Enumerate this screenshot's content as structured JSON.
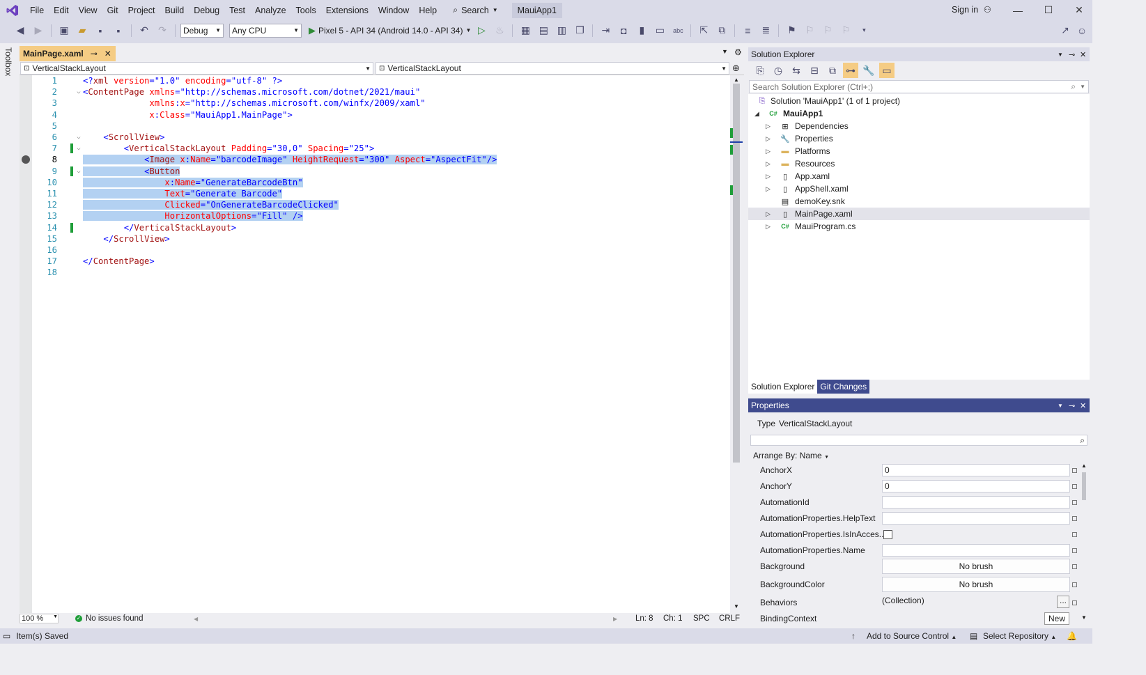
{
  "menu": {
    "items": [
      "File",
      "Edit",
      "View",
      "Git",
      "Project",
      "Build",
      "Debug",
      "Test",
      "Analyze",
      "Tools",
      "Extensions",
      "Window",
      "Help"
    ],
    "search_label": "Search",
    "solution_badge": "MauiApp1",
    "sign_in": "Sign in"
  },
  "toolbar": {
    "config": "Debug",
    "platform": "Any CPU",
    "run_target": "Pixel 5 - API 34 (Android 14.0 - API 34)"
  },
  "toolbox_label": "Toolbox",
  "editor": {
    "tab_title": "MainPage.xaml",
    "nav_left": "VerticalStackLayout",
    "nav_right": "VerticalStackLayout",
    "zoom": "100 %",
    "issues": "No issues found",
    "ln": "Ln: 8",
    "ch": "Ch: 1",
    "spc": "SPC",
    "crlf": "CRLF",
    "current_line": 8,
    "lines": [
      {
        "n": "1",
        "tokens": [
          [
            "c-blue",
            "<?"
          ],
          [
            "c-brown",
            "xml"
          ],
          [
            "c-red",
            " version"
          ],
          [
            "c-blue",
            "="
          ],
          [
            "c-str",
            "\"1.0\""
          ],
          [
            "c-red",
            " encoding"
          ],
          [
            "c-blue",
            "="
          ],
          [
            "c-str",
            "\"utf-8\""
          ],
          [
            "c-blue",
            " ?>"
          ]
        ]
      },
      {
        "n": "2",
        "tokens": [
          [
            "c-blue",
            "<"
          ],
          [
            "c-brown",
            "ContentPage"
          ],
          [
            "c-red",
            " xmlns"
          ],
          [
            "c-blue",
            "="
          ],
          [
            "c-str",
            "\"http://schemas.microsoft.com/dotnet/2021/maui\""
          ]
        ]
      },
      {
        "n": "3",
        "tokens": [
          [
            "",
            "             "
          ],
          [
            "c-red",
            "xmlns"
          ],
          [
            "c-blue",
            ":"
          ],
          [
            "c-red",
            "x"
          ],
          [
            "c-blue",
            "="
          ],
          [
            "c-str",
            "\"http://schemas.microsoft.com/winfx/2009/xaml\""
          ]
        ]
      },
      {
        "n": "4",
        "tokens": [
          [
            "",
            "             "
          ],
          [
            "c-red",
            "x"
          ],
          [
            "c-blue",
            ":"
          ],
          [
            "c-red",
            "Class"
          ],
          [
            "c-blue",
            "="
          ],
          [
            "c-str",
            "\"MauiApp1.MainPage\""
          ],
          [
            "c-blue",
            ">"
          ]
        ]
      },
      {
        "n": "5",
        "tokens": []
      },
      {
        "n": "6",
        "tokens": [
          [
            "",
            "    "
          ],
          [
            "c-blue",
            "<"
          ],
          [
            "c-brown",
            "ScrollView"
          ],
          [
            "c-blue",
            ">"
          ]
        ]
      },
      {
        "n": "7",
        "tokens": [
          [
            "",
            "        "
          ],
          [
            "c-blue",
            "<"
          ],
          [
            "c-brown",
            "VerticalStackLayout"
          ],
          [
            "c-red",
            " Padding"
          ],
          [
            "c-blue",
            "="
          ],
          [
            "c-str",
            "\"30,0\""
          ],
          [
            "c-red",
            " Spacing"
          ],
          [
            "c-blue",
            "="
          ],
          [
            "c-str",
            "\"25\""
          ],
          [
            "c-blue",
            ">"
          ]
        ]
      },
      {
        "n": "8",
        "sel": true,
        "tokens": [
          [
            "",
            "            "
          ],
          [
            "c-blue",
            "<"
          ],
          [
            "c-brown",
            "Image"
          ],
          [
            "c-red",
            " x"
          ],
          [
            "c-blue",
            ":"
          ],
          [
            "c-red",
            "Name"
          ],
          [
            "c-blue",
            "="
          ],
          [
            "c-str",
            "\"barcodeImage\""
          ],
          [
            "c-red",
            " HeightRequest"
          ],
          [
            "c-blue",
            "="
          ],
          [
            "c-str",
            "\"300\""
          ],
          [
            "c-red",
            " Aspect"
          ],
          [
            "c-blue",
            "="
          ],
          [
            "c-str",
            "\"AspectFit\""
          ],
          [
            "c-blue",
            "/>"
          ]
        ]
      },
      {
        "n": "9",
        "sel": true,
        "tokens": [
          [
            "",
            "            "
          ],
          [
            "c-blue",
            "<"
          ],
          [
            "c-brown",
            "Button"
          ]
        ]
      },
      {
        "n": "10",
        "sel": true,
        "tokens": [
          [
            "",
            "                "
          ],
          [
            "c-red",
            "x"
          ],
          [
            "c-blue",
            ":"
          ],
          [
            "c-red",
            "Name"
          ],
          [
            "c-blue",
            "="
          ],
          [
            "c-str",
            "\"GenerateBarcodeBtn\""
          ]
        ]
      },
      {
        "n": "11",
        "sel": true,
        "tokens": [
          [
            "",
            "                "
          ],
          [
            "c-red",
            "Text"
          ],
          [
            "c-blue",
            "="
          ],
          [
            "c-str",
            "\"Generate Barcode\""
          ]
        ]
      },
      {
        "n": "12",
        "sel": true,
        "tokens": [
          [
            "",
            "                "
          ],
          [
            "c-red",
            "Clicked"
          ],
          [
            "c-blue",
            "="
          ],
          [
            "c-str",
            "\"OnGenerateBarcodeClicked\""
          ]
        ]
      },
      {
        "n": "13",
        "sel": true,
        "tokens": [
          [
            "",
            "                "
          ],
          [
            "c-red",
            "HorizontalOptions"
          ],
          [
            "c-blue",
            "="
          ],
          [
            "c-str",
            "\"Fill\""
          ],
          [
            "c-blue",
            " />"
          ]
        ]
      },
      {
        "n": "14",
        "tokens": [
          [
            "",
            "        "
          ],
          [
            "c-blue",
            "</"
          ],
          [
            "c-brown",
            "VerticalStackLayout"
          ],
          [
            "c-blue",
            ">"
          ]
        ]
      },
      {
        "n": "15",
        "tokens": [
          [
            "",
            "    "
          ],
          [
            "c-blue",
            "</"
          ],
          [
            "c-brown",
            "ScrollView"
          ],
          [
            "c-blue",
            ">"
          ]
        ]
      },
      {
        "n": "16",
        "tokens": []
      },
      {
        "n": "17",
        "tokens": [
          [
            "c-blue",
            "</"
          ],
          [
            "c-brown",
            "ContentPage"
          ],
          [
            "c-blue",
            ">"
          ]
        ]
      },
      {
        "n": "18",
        "tokens": []
      }
    ]
  },
  "solution_explorer": {
    "title": "Solution Explorer",
    "search_placeholder": "Search Solution Explorer (Ctrl+;)",
    "solution_label": "Solution 'MauiApp1' (1 of 1 project)",
    "project": "MauiApp1",
    "items": [
      {
        "label": "Dependencies",
        "icon": "dependencies-icon",
        "glyph": "⊞",
        "arrow": true
      },
      {
        "label": "Properties",
        "icon": "wrench-icon",
        "glyph": "🔧",
        "arrow": true
      },
      {
        "label": "Platforms",
        "icon": "folder-icon",
        "glyph": "▬",
        "arrow": true
      },
      {
        "label": "Resources",
        "icon": "folder-icon",
        "glyph": "▬",
        "arrow": true
      },
      {
        "label": "App.xaml",
        "icon": "xaml-file-icon",
        "glyph": "▯",
        "arrow": true
      },
      {
        "label": "AppShell.xaml",
        "icon": "xaml-file-icon",
        "glyph": "▯",
        "arrow": true
      },
      {
        "label": "demoKey.snk",
        "icon": "key-file-icon",
        "glyph": "▤",
        "arrow": false
      },
      {
        "label": "MainPage.xaml",
        "icon": "xaml-file-icon",
        "glyph": "▯",
        "arrow": true,
        "selected": true
      },
      {
        "label": "MauiProgram.cs",
        "icon": "csharp-file-icon",
        "glyph": "C#",
        "arrow": true
      }
    ],
    "tab_active": "Solution Explorer",
    "tab_inactive": "Git Changes"
  },
  "properties": {
    "title": "Properties",
    "type_label": "Type",
    "type_value": "VerticalStackLayout",
    "arrange": "Arrange By: Name",
    "rows": [
      {
        "name": "AnchorX",
        "value": "0",
        "kind": "text"
      },
      {
        "name": "AnchorY",
        "value": "0",
        "kind": "text"
      },
      {
        "name": "AutomationId",
        "value": "",
        "kind": "text"
      },
      {
        "name": "AutomationProperties.HelpText",
        "value": "",
        "kind": "text"
      },
      {
        "name": "AutomationProperties.IsInAcces...",
        "value": "",
        "kind": "check"
      },
      {
        "name": "AutomationProperties.Name",
        "value": "",
        "kind": "text"
      },
      {
        "name": "Background",
        "value": "No brush",
        "kind": "button"
      },
      {
        "name": "BackgroundColor",
        "value": "No brush",
        "kind": "button"
      },
      {
        "name": "Behaviors",
        "value": "(Collection)",
        "kind": "collection"
      },
      {
        "name": "BindingContext",
        "value": "New",
        "kind": "new"
      }
    ]
  },
  "status": {
    "saved": "Item(s) Saved",
    "source_control": "Add to Source Control",
    "repository": "Select Repository"
  }
}
